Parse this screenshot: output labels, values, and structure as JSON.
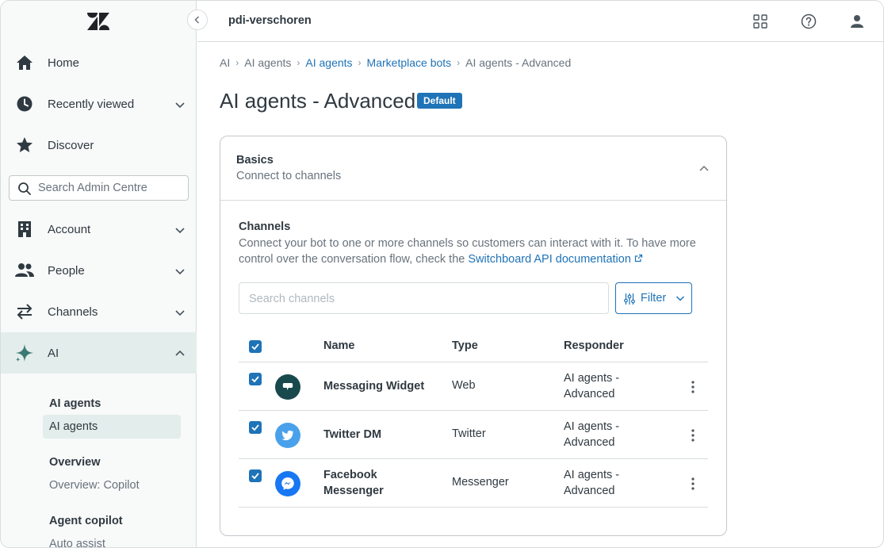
{
  "workspace": "pdi-verschoren",
  "sidebar": {
    "nav": [
      {
        "label": "Home",
        "icon": "home-icon"
      },
      {
        "label": "Recently viewed",
        "icon": "clock-icon"
      },
      {
        "label": "Discover",
        "icon": "star-icon"
      },
      {
        "label": "Account",
        "icon": "building-icon"
      },
      {
        "label": "People",
        "icon": "people-icon"
      },
      {
        "label": "Channels",
        "icon": "arrows-icon"
      },
      {
        "label": "AI",
        "icon": "sparkle-icon"
      }
    ],
    "search_placeholder": "Search Admin Centre",
    "ai_sub": {
      "group1_heading": "AI agents",
      "group1_active": "AI agents",
      "group2_heading": "Overview",
      "group2_link": "Overview: Copilot",
      "group3_heading": "Agent copilot",
      "group3_link": "Auto assist"
    }
  },
  "breadcrumb": [
    "AI",
    "AI agents",
    "AI agents",
    "Marketplace bots",
    "AI agents - Advanced"
  ],
  "page": {
    "title": "AI agents - Advanced",
    "badge": "Default"
  },
  "card": {
    "header_title": "Basics",
    "header_subtitle": "Connect to channels",
    "section_title": "Channels",
    "section_desc": "Connect your bot to one or more channels so customers can interact with it. To have more control over the conversation flow, check the",
    "section_link": "Switchboard API documentation",
    "search_placeholder": "Search channels",
    "filter_label": "Filter",
    "columns": [
      "Name",
      "Type",
      "Responder"
    ],
    "rows": [
      {
        "name": "Messaging Widget",
        "type": "Web",
        "responder": "AI agents - Advanced",
        "icon": "messaging-widget-icon",
        "color": "#17494d"
      },
      {
        "name": "Twitter DM",
        "type": "Twitter",
        "responder": "AI agents - Advanced",
        "icon": "twitter-icon",
        "color": "#4aa1eb"
      },
      {
        "name": "Facebook Messenger",
        "type": "Messenger",
        "responder": "AI agents - Advanced",
        "icon": "messenger-icon",
        "color": "#1877f2"
      }
    ]
  },
  "colors": {
    "accent": "#1f73b7",
    "active_nav_bg": "#e3edeb"
  }
}
